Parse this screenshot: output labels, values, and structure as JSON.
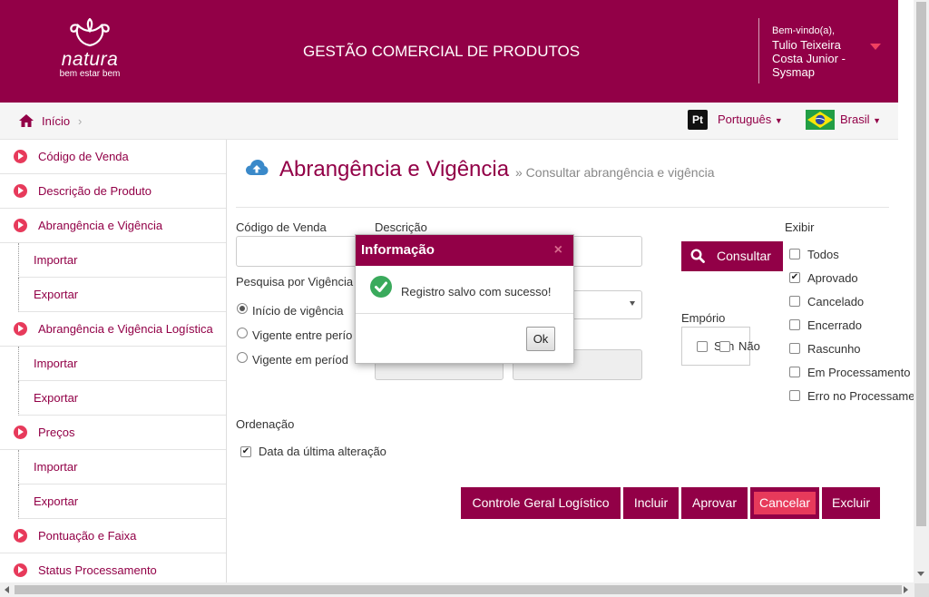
{
  "header": {
    "logo_brand": "natura",
    "logo_tagline": "bem estar bem",
    "app_title": "GESTÃO COMERCIAL DE PRODUTOS",
    "welcome": "Bem-vindo(a),",
    "user_name": "Tulio Teixeira Costa Junior - Sysmap",
    "brand_color": "#920047"
  },
  "breadcrumb": {
    "home_label": "Início"
  },
  "language": {
    "icon_text": "Pt",
    "label": "Português",
    "country": "Brasil"
  },
  "sidebar": {
    "items": [
      {
        "label": "Código de Venda",
        "type": "main"
      },
      {
        "label": "Descrição de Produto",
        "type": "main"
      },
      {
        "label": "Abrangência e Vigência",
        "type": "main"
      },
      {
        "label": "Importar",
        "type": "sub"
      },
      {
        "label": "Exportar",
        "type": "sub"
      },
      {
        "label": "Abrangência e Vigência Logística",
        "type": "main"
      },
      {
        "label": "Importar",
        "type": "sub"
      },
      {
        "label": "Exportar",
        "type": "sub"
      },
      {
        "label": "Preços",
        "type": "main"
      },
      {
        "label": "Importar",
        "type": "sub"
      },
      {
        "label": "Exportar",
        "type": "sub"
      },
      {
        "label": "Pontuação e Faixa",
        "type": "main"
      },
      {
        "label": "Status Processamento",
        "type": "main"
      }
    ]
  },
  "page": {
    "title": "Abrangência e Vigência",
    "subtitle": "» Consultar abrangência e vigência"
  },
  "form": {
    "codigo_label": "Código de Venda",
    "descricao_label": "Descrição",
    "pesquisa_label": "Pesquisa por Vigência",
    "radio_inicio": "Início de vigência",
    "radio_vigente_entre": "Vigente entre perío",
    "radio_vigente_em": "Vigente em períod",
    "consultar_label": "Consultar",
    "emporio_label": "Empório",
    "emporio_sim": "Sim",
    "emporio_nao": "Não",
    "exibir_label": "Exibir",
    "exibir_options": [
      {
        "label": "Todos",
        "checked": false
      },
      {
        "label": "Aprovado",
        "checked": true
      },
      {
        "label": "Cancelado",
        "checked": false
      },
      {
        "label": "Encerrado",
        "checked": false
      },
      {
        "label": "Rascunho",
        "checked": false
      },
      {
        "label": "Em Processamento",
        "checked": false
      },
      {
        "label": "Erro no Processame",
        "checked": false
      }
    ],
    "ordenacao_label": "Ordenação",
    "ordenacao_option": "Data da última alteração"
  },
  "actions": {
    "controle": "Controle Geral Logístico",
    "incluir": "Incluir",
    "aprovar": "Aprovar",
    "cancelar": "Cancelar",
    "excluir": "Excluir"
  },
  "modal": {
    "title": "Informação",
    "close": "×",
    "message": "Registro salvo com sucesso!",
    "ok": "Ok"
  }
}
